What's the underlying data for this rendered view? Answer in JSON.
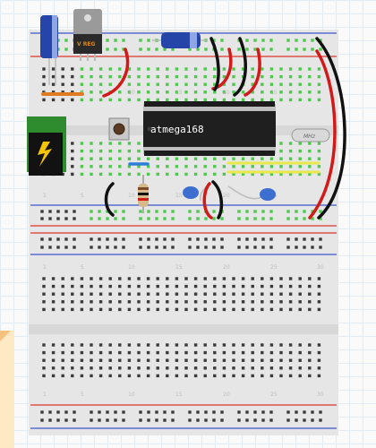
{
  "diagram": {
    "microcontroller_label": "atmega168",
    "regulator_label": "V REG",
    "crystal_label": "MHz",
    "column_numbers": [
      "1",
      "5",
      "10",
      "15",
      "20",
      "25",
      "30"
    ],
    "colors": {
      "board": "#e6e6e6",
      "hole": "#3a3a3a",
      "connected_hole": "#4cc94c",
      "rail_red": "#d9372b",
      "rail_blue": "#3b56c9",
      "wire_red": "#d11a1a",
      "wire_black": "#111111",
      "wire_orange": "#e07a22",
      "wire_yellow": "#e8e84a",
      "wire_blue": "#2b7fd6",
      "capacitor_blue": "#2545a8",
      "ceramic_cap": "#3d6fd0",
      "power_jack_green": "#2e8b2e"
    }
  }
}
